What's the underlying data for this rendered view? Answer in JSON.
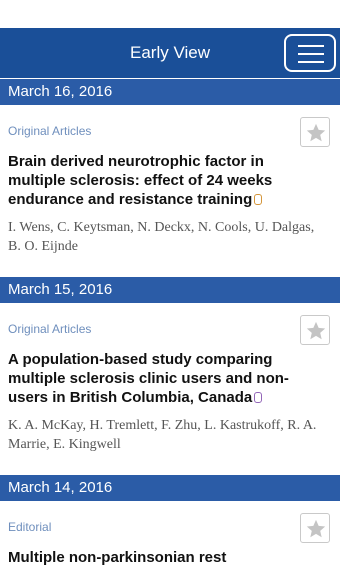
{
  "appbar": {
    "title": "Early View",
    "menu_icon": "hamburger-menu-icon"
  },
  "sections": [
    {
      "date": "March 16, 2016",
      "category": "Original Articles",
      "title": "Brain derived neurotrophic factor in multiple sclerosis: effect of 24 weeks endurance and resistance training",
      "access_icon": "open-access-lock-icon",
      "authors": "I. Wens, C. Keytsman, N. Deckx, N. Cools, U. Dalgas, B. O. Eijnde"
    },
    {
      "date": "March 15, 2016",
      "category": "Original Articles",
      "title": "A population-based study comparing multiple sclerosis clinic users and non-users in British Columbia, Canada",
      "access_icon": "access-lock-icon",
      "authors": "K. A. McKay, H. Tremlett, F. Zhu, L. Kastrukoff, R. A. Marrie, E. Kingwell"
    },
    {
      "date": "March 14, 2016",
      "category": "Editorial",
      "title": "Multiple non-parkinsonian rest",
      "authors": ""
    }
  ],
  "colors": {
    "appbar": "#1a4f98",
    "date_bar": "#2b5ca7",
    "category": "#6f8fbd",
    "open_access": "#d4953a",
    "restricted": "#9366b8"
  }
}
